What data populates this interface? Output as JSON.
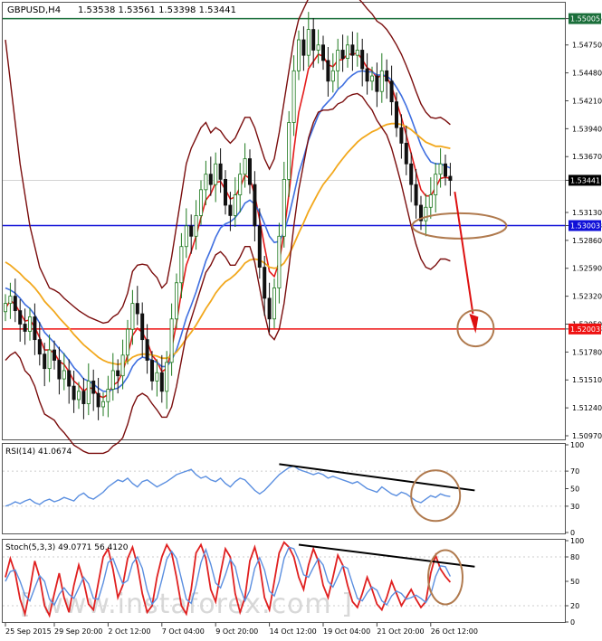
{
  "header": {
    "symbol": "GBPUSD,H4",
    "ohlc": "1.53538 1.53561 1.53398 1.53441"
  },
  "colors": {
    "background": "#ffffff",
    "candle_up": "#1f7a1f",
    "candle_down": "#111111",
    "ema_fast": "#e41b1b",
    "ema_mid": "#3f6fe0",
    "ema_slow": "#f2a81d",
    "bollinger": "#7a0d0d",
    "resistance_line": "#1a6e3a",
    "support_line": "#1010d8",
    "target_line": "#ee1111",
    "rsi": "#5b8fe0",
    "stoch_main": "#e02020",
    "stoch_signal": "#5b8fe0",
    "circle": "#b07a4e",
    "arrow": "#dd1111",
    "watermark": "#d8d8d8"
  },
  "watermark": "[ www.instaforex.com ]",
  "x_axis_labels": [
    "25 Sep 2015",
    "29 Sep 20:00",
    "2 Oct 12:00",
    "7 Oct 04:00",
    "9 Oct 20:00",
    "14 Oct 12:00",
    "19 Oct 04:00",
    "21 Oct 20:00",
    "26 Oct 12:00"
  ],
  "chart_data": [
    {
      "type": "line",
      "panel": "price",
      "title": "GBPUSD,H4",
      "subtitle": "1.53538 1.53561 1.53398 1.53441",
      "y_ticks": [
        "1.55005",
        "1.54750",
        "1.54480",
        "1.54210",
        "1.53940",
        "1.53670",
        "1.53441",
        "1.53130",
        "1.53003",
        "1.52860",
        "1.52590",
        "1.52320",
        "1.52050",
        "1.52003",
        "1.51780",
        "1.51510",
        "1.51240",
        "1.50970"
      ],
      "ylim": [
        1.50935,
        1.5515
      ],
      "horizontal_levels": [
        {
          "label": "1.55005",
          "value": 1.55005,
          "color": "#1a6e3a"
        },
        {
          "label": "1.53003",
          "value": 1.53003,
          "color": "#1010d8"
        },
        {
          "label": "1.52003",
          "value": 1.52003,
          "color": "#ee1111"
        }
      ],
      "current_price_label": "1.53441",
      "current_price": 1.53441,
      "candles_close": [
        1.5225,
        1.5232,
        1.5218,
        1.5205,
        1.5198,
        1.5212,
        1.519,
        1.5176,
        1.5162,
        1.518,
        1.517,
        1.5152,
        1.516,
        1.5145,
        1.5132,
        1.514,
        1.5128,
        1.515,
        1.5138,
        1.5125,
        1.513,
        1.5142,
        1.516,
        1.5155,
        1.5175,
        1.52,
        1.5225,
        1.5215,
        1.519,
        1.517,
        1.515,
        1.5158,
        1.514,
        1.5168,
        1.521,
        1.5245,
        1.528,
        1.53,
        1.529,
        1.531,
        1.5335,
        1.535,
        1.534,
        1.536,
        1.5345,
        1.532,
        1.531,
        1.533,
        1.535,
        1.5365,
        1.534,
        1.53,
        1.526,
        1.523,
        1.521,
        1.524,
        1.529,
        1.5345,
        1.54,
        1.545,
        1.548,
        1.5465,
        1.549,
        1.547,
        1.5475,
        1.546,
        1.544,
        1.545,
        1.547,
        1.5462,
        1.5475,
        1.5465,
        1.547,
        1.5452,
        1.544,
        1.5445,
        1.543,
        1.545,
        1.544,
        1.542,
        1.5395,
        1.538,
        1.536,
        1.534,
        1.532,
        1.5305,
        1.5318,
        1.533,
        1.535,
        1.536,
        1.5348,
        1.5344
      ],
      "series": [
        {
          "values": [
            1.522,
            1.5228,
            1.5224,
            1.5216,
            1.5208,
            1.5209,
            1.5202,
            1.5192,
            1.518,
            1.518,
            1.5177,
            1.5169,
            1.5166,
            1.5159,
            1.515,
            1.5146,
            1.514,
            1.5144,
            1.5142,
            1.5136,
            1.5134,
            1.5137,
            1.5146,
            1.5149,
            1.5159,
            1.5175,
            1.5194,
            1.5201,
            1.5197,
            1.5188,
            1.5175,
            1.5169,
            1.5159,
            1.5162,
            1.5181,
            1.5206,
            1.5236,
            1.5262,
            1.5275,
            1.529,
            1.5308,
            1.5325,
            1.5331,
            1.5342,
            1.5343,
            1.5335,
            1.5326,
            1.5328,
            1.5337,
            1.5349,
            1.5346,
            1.533,
            1.5306,
            1.528,
            1.5256,
            1.5251,
            1.5265,
            1.5294,
            1.5331,
            1.5373,
            1.541,
            1.543,
            1.5452,
            1.5459,
            1.5466,
            1.5464,
            1.5456,
            1.5454,
            1.546,
            1.5461,
            1.5466,
            1.5466,
            1.5467,
            1.5461,
            1.5453,
            1.545,
            1.5443,
            1.5446,
            1.5444,
            1.5435,
            1.542,
            1.5405,
            1.5388,
            1.537,
            1.5352,
            1.5335,
            1.5329,
            1.5329,
            1.5337,
            1.5346,
            1.5347,
            1.5346
          ]
        },
        {
          "values": [
            1.524,
            1.5238,
            1.5235,
            1.523,
            1.5224,
            1.522,
            1.5214,
            1.5206,
            1.5197,
            1.5192,
            1.5187,
            1.5181,
            1.5176,
            1.517,
            1.5163,
            1.5158,
            1.5152,
            1.515,
            1.5147,
            1.5143,
            1.514,
            1.514,
            1.5142,
            1.5143,
            1.5147,
            1.5154,
            1.5164,
            1.517,
            1.5173,
            1.5172,
            1.517,
            1.5168,
            1.5164,
            1.5164,
            1.517,
            1.518,
            1.5195,
            1.5211,
            1.5223,
            1.5236,
            1.5251,
            1.5266,
            1.5277,
            1.5289,
            1.5298,
            1.5302,
            1.5304,
            1.5308,
            1.5314,
            1.5322,
            1.5325,
            1.5321,
            1.5313,
            1.5302,
            1.529,
            1.5284,
            1.5285,
            1.5294,
            1.531,
            1.533,
            1.5351,
            1.5366,
            1.5383,
            1.5395,
            1.5407,
            1.5415,
            1.542,
            1.5425,
            1.5432,
            1.5436,
            1.5442,
            1.5446,
            1.5449,
            1.545,
            1.5449,
            1.5449,
            1.5446,
            1.5446,
            1.5445,
            1.5441,
            1.5434,
            1.5426,
            1.5416,
            1.5404,
            1.5391,
            1.5378,
            1.5369,
            1.5362,
            1.536,
            1.536,
            1.5358,
            1.5356
          ]
        },
        {
          "values": [
            1.5265,
            1.5262,
            1.5258,
            1.5254,
            1.5249,
            1.5245,
            1.524,
            1.5234,
            1.5227,
            1.5222,
            1.5217,
            1.5211,
            1.5206,
            1.5201,
            1.5195,
            1.519,
            1.5185,
            1.5181,
            1.5177,
            1.5173,
            1.517,
            1.5168,
            1.5167,
            1.5166,
            1.5167,
            1.5169,
            1.5173,
            1.5175,
            1.5176,
            1.5176,
            1.5175,
            1.5174,
            1.5172,
            1.5172,
            1.5174,
            1.5178,
            1.5184,
            1.5191,
            1.5197,
            1.5204,
            1.5212,
            1.522,
            1.5227,
            1.5235,
            1.5241,
            1.5246,
            1.5249,
            1.5253,
            1.5258,
            1.5264,
            1.5267,
            1.5268,
            1.5267,
            1.5264,
            1.526,
            1.5259,
            1.526,
            1.5264,
            1.5272,
            1.5282,
            1.5293,
            1.5303,
            1.5314,
            1.5323,
            1.5332,
            1.534,
            1.5346,
            1.5352,
            1.5359,
            1.5365,
            1.5371,
            1.5376,
            1.5381,
            1.5385,
            1.5388,
            1.5391,
            1.5393,
            1.5396,
            1.5398,
            1.5399,
            1.5399,
            1.5398,
            1.5396,
            1.5393,
            1.5389,
            1.5385,
            1.5381,
            1.5379,
            1.5377,
            1.5377,
            1.5376,
            1.5375
          ]
        },
        {
          "values": [
            1.548,
            1.544,
            1.54,
            1.536,
            1.533,
            1.53,
            1.528,
            1.526,
            1.525,
            1.524,
            1.5238,
            1.5235,
            1.523,
            1.5226,
            1.5222,
            1.5218,
            1.5215,
            1.5212,
            1.521,
            1.5208,
            1.5206,
            1.5207,
            1.5212,
            1.5215,
            1.5222,
            1.5235,
            1.5256,
            1.5262,
            1.5263,
            1.5262,
            1.5255,
            1.525,
            1.524,
            1.5245,
            1.527,
            1.53,
            1.533,
            1.536,
            1.5375,
            1.5385,
            1.5395,
            1.54,
            1.539,
            1.5395,
            1.5392,
            1.5385,
            1.538,
            1.5385,
            1.5395,
            1.5405,
            1.5405,
            1.5395,
            1.538,
            1.5365,
            1.5355,
            1.5365,
            1.539,
            1.542,
            1.545,
            1.548,
            1.55,
            1.551,
            1.552,
            1.5525,
            1.5528,
            1.5527,
            1.5522,
            1.552,
            1.5523,
            1.5522,
            1.5524,
            1.5522,
            1.5521,
            1.5516,
            1.551,
            1.5505,
            1.5498,
            1.5495,
            1.549,
            1.5483,
            1.5475,
            1.5466,
            1.5455,
            1.5443,
            1.543,
            1.5418,
            1.541,
            1.5405,
            1.5404,
            1.5405,
            1.5402,
            1.5398
          ]
        },
        {
          "values": [
            1.517,
            1.5175,
            1.5178,
            1.5172,
            1.516,
            1.5155,
            1.5145,
            1.513,
            1.5118,
            1.5115,
            1.5112,
            1.5105,
            1.51,
            1.5094,
            1.5088,
            1.5085,
            1.5082,
            1.508,
            1.508,
            1.508,
            1.508,
            1.5082,
            1.5087,
            1.509,
            1.5095,
            1.5108,
            1.5125,
            1.5135,
            1.5138,
            1.5135,
            1.5128,
            1.5122,
            1.5115,
            1.5115,
            1.5125,
            1.5145,
            1.517,
            1.5195,
            1.521,
            1.5225,
            1.524,
            1.5255,
            1.5262,
            1.5272,
            1.5275,
            1.527,
            1.5262,
            1.5262,
            1.527,
            1.528,
            1.528,
            1.5265,
            1.524,
            1.5215,
            1.5195,
            1.519,
            1.52,
            1.5225,
            1.526,
            1.53,
            1.5335,
            1.536,
            1.5385,
            1.54,
            1.541,
            1.5412,
            1.5412,
            1.5413,
            1.5418,
            1.542,
            1.5425,
            1.5427,
            1.5428,
            1.5425,
            1.5418,
            1.5412,
            1.5402,
            1.5395,
            1.5388,
            1.5375,
            1.5358,
            1.534,
            1.532,
            1.53,
            1.5282,
            1.5268,
            1.526,
            1.5258,
            1.5262,
            1.5268,
            1.5268,
            1.5266
          ]
        }
      ]
    },
    {
      "type": "line",
      "panel": "rsi",
      "title": "RSI(14) 41.0674",
      "y_ticks": [
        "100",
        "70",
        "50",
        "30",
        "0"
      ],
      "ylim": [
        0,
        100
      ],
      "series": [
        {
          "values": [
            30,
            32,
            35,
            33,
            36,
            38,
            34,
            32,
            36,
            38,
            35,
            37,
            40,
            38,
            36,
            42,
            45,
            40,
            38,
            42,
            46,
            52,
            56,
            60,
            58,
            62,
            56,
            52,
            58,
            60,
            56,
            52,
            55,
            58,
            62,
            66,
            68,
            70,
            72,
            66,
            62,
            64,
            60,
            58,
            62,
            56,
            52,
            58,
            62,
            60,
            54,
            48,
            44,
            48,
            54,
            60,
            66,
            70,
            74,
            76,
            72,
            70,
            68,
            66,
            68,
            66,
            62,
            64,
            62,
            60,
            58,
            56,
            58,
            54,
            50,
            48,
            46,
            52,
            48,
            44,
            42,
            46,
            44,
            40,
            36,
            34,
            38,
            42,
            40,
            44,
            42,
            41
          ]
        }
      ]
    },
    {
      "type": "line",
      "panel": "stochastic",
      "title": "Stoch(5,3,3) 49.0771 56.4120",
      "y_ticks": [
        "100",
        "80",
        "50",
        "20",
        "0"
      ],
      "ylim": [
        0,
        100
      ],
      "series": [
        {
          "values": [
            55,
            78,
            60,
            28,
            10,
            40,
            75,
            55,
            20,
            8,
            35,
            60,
            30,
            12,
            45,
            70,
            50,
            22,
            15,
            48,
            80,
            90,
            65,
            30,
            45,
            78,
            92,
            70,
            35,
            12,
            20,
            55,
            80,
            95,
            85,
            55,
            20,
            10,
            40,
            85,
            95,
            78,
            40,
            25,
            60,
            90,
            80,
            35,
            12,
            30,
            75,
            92,
            70,
            30,
            15,
            50,
            85,
            98,
            92,
            80,
            55,
            40,
            70,
            90,
            75,
            45,
            30,
            55,
            82,
            70,
            45,
            25,
            18,
            35,
            55,
            40,
            22,
            15,
            30,
            50,
            35,
            20,
            30,
            40,
            28,
            18,
            25,
            60,
            82,
            65,
            56,
            49
          ]
        },
        {
          "values": [
            50,
            62,
            64,
            50,
            33,
            26,
            42,
            57,
            50,
            28,
            21,
            34,
            42,
            34,
            29,
            42,
            55,
            47,
            29,
            28,
            48,
            73,
            78,
            62,
            47,
            51,
            72,
            80,
            66,
            39,
            22,
            29,
            52,
            77,
            87,
            78,
            53,
            28,
            23,
            45,
            73,
            89,
            71,
            48,
            42,
            58,
            77,
            68,
            42,
            26,
            39,
            66,
            79,
            64,
            38,
            32,
            50,
            78,
            92,
            90,
            76,
            58,
            55,
            67,
            78,
            70,
            50,
            43,
            56,
            69,
            66,
            47,
            29,
            26,
            36,
            43,
            39,
            26,
            21,
            32,
            38,
            35,
            28,
            30,
            33,
            29,
            24,
            34,
            56,
            69,
            68,
            56
          ]
        }
      ]
    }
  ]
}
